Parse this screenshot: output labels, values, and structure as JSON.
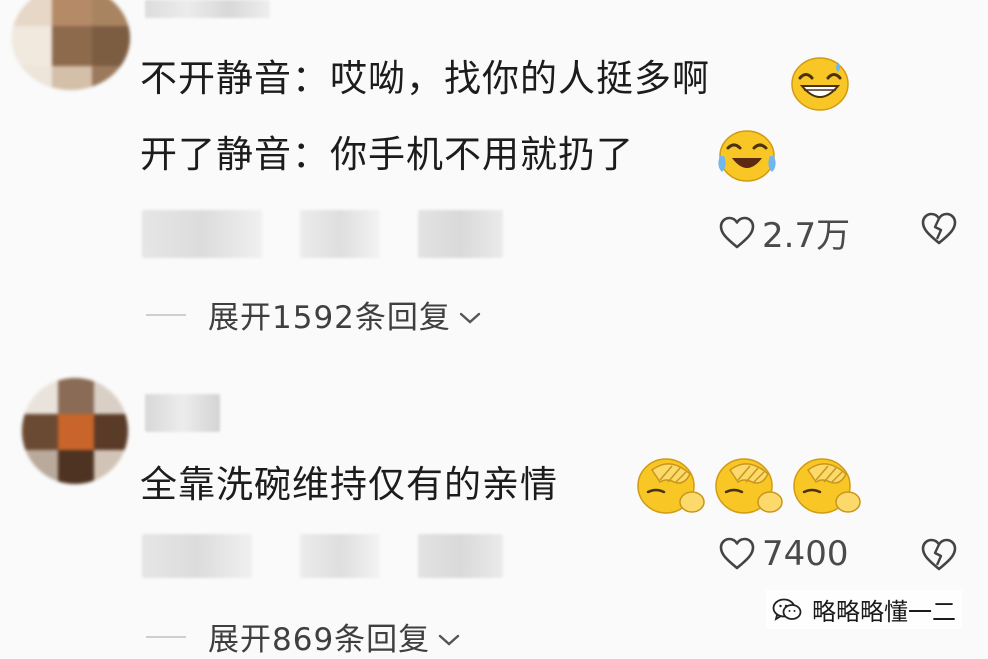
{
  "comments": [
    {
      "lines": [
        "不开静音：哎呦，找你的人挺多啊",
        "开了静音：你手机不用就扔了"
      ],
      "likes": "2.7万",
      "expand_label": "展开1592条回复"
    },
    {
      "lines": [
        "全靠洗碗维持仅有的亲情"
      ],
      "likes": "7400",
      "expand_label": "展开869条回复"
    }
  ],
  "icons": {
    "like": "heart-outline-icon",
    "dislike": "broken-heart-icon",
    "expand": "chevron-down-icon",
    "emoji_1": "grinning-sweat-emoji",
    "emoji_2": "tears-of-joy-emoji",
    "emoji_3": "facepalm-emoji",
    "watermark": "wechat-icon"
  },
  "watermark": {
    "text": "略略略懂一二"
  },
  "colors": {
    "background": "#fafafa",
    "text": "#1c1c1c",
    "meta": "#4a4a4a",
    "emoji_yellow": "#f8c625"
  }
}
